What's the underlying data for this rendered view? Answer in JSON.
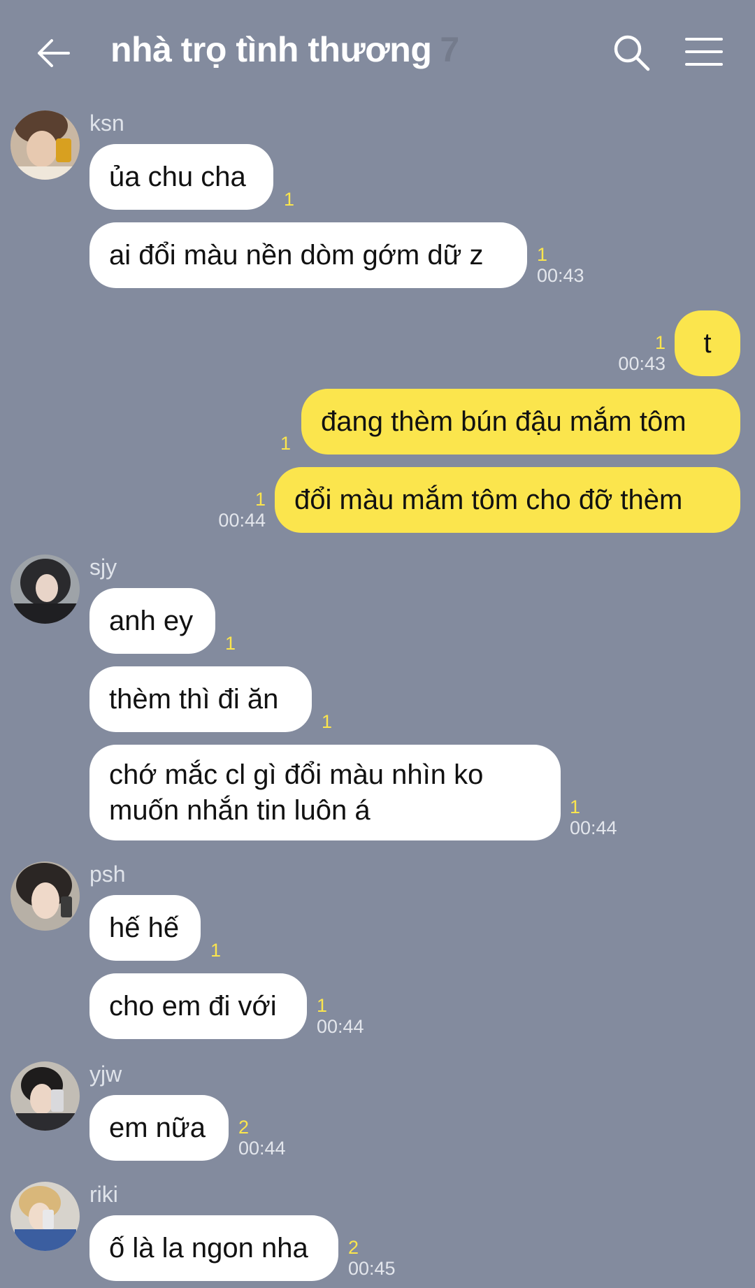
{
  "header": {
    "title": "nhà trọ tình thương",
    "member_count": "7"
  },
  "colors": {
    "background": "#838b9e",
    "my_bubble": "#fbe54d",
    "other_bubble": "#ffffff",
    "unread": "#fbe54d"
  },
  "icons": {
    "back": "arrow-left-icon",
    "search": "search-icon",
    "menu": "hamburger-menu-icon"
  },
  "messages": {
    "ksn": {
      "name": "ksn",
      "m1": "ủa chu cha",
      "m1_unread": "1",
      "m2": "ai đổi màu nền dòm gớm dữ z",
      "m2_unread": "1",
      "m2_time": "00:43"
    },
    "me": {
      "m1": "t",
      "m1_unread": "1",
      "m1_time": "00:43",
      "m2": "đang thèm bún đậu mắm tôm",
      "m2_unread": "1",
      "m3": "đổi màu mắm tôm cho đỡ thèm",
      "m3_unread": "1",
      "m3_time": "00:44"
    },
    "sjy": {
      "name": "sjy",
      "m1": "anh ey",
      "m1_unread": "1",
      "m2": "thèm thì đi ăn",
      "m2_unread": "1",
      "m3_line1": "chớ mắc cl gì đổi màu nhìn ko",
      "m3_line2": "muốn nhắn tin luôn á",
      "m3_unread": "1",
      "m3_time": "00:44"
    },
    "psh": {
      "name": "psh",
      "m1": "hế hế",
      "m1_unread": "1",
      "m2": "cho em đi với",
      "m2_unread": "1",
      "m2_time": "00:44"
    },
    "yjw": {
      "name": "yjw",
      "m1": "em nữa",
      "m1_unread": "2",
      "m1_time": "00:44"
    },
    "riki": {
      "name": "riki",
      "m1": "ố là la ngon nha",
      "m1_unread": "2",
      "m1_time": "00:45"
    }
  }
}
